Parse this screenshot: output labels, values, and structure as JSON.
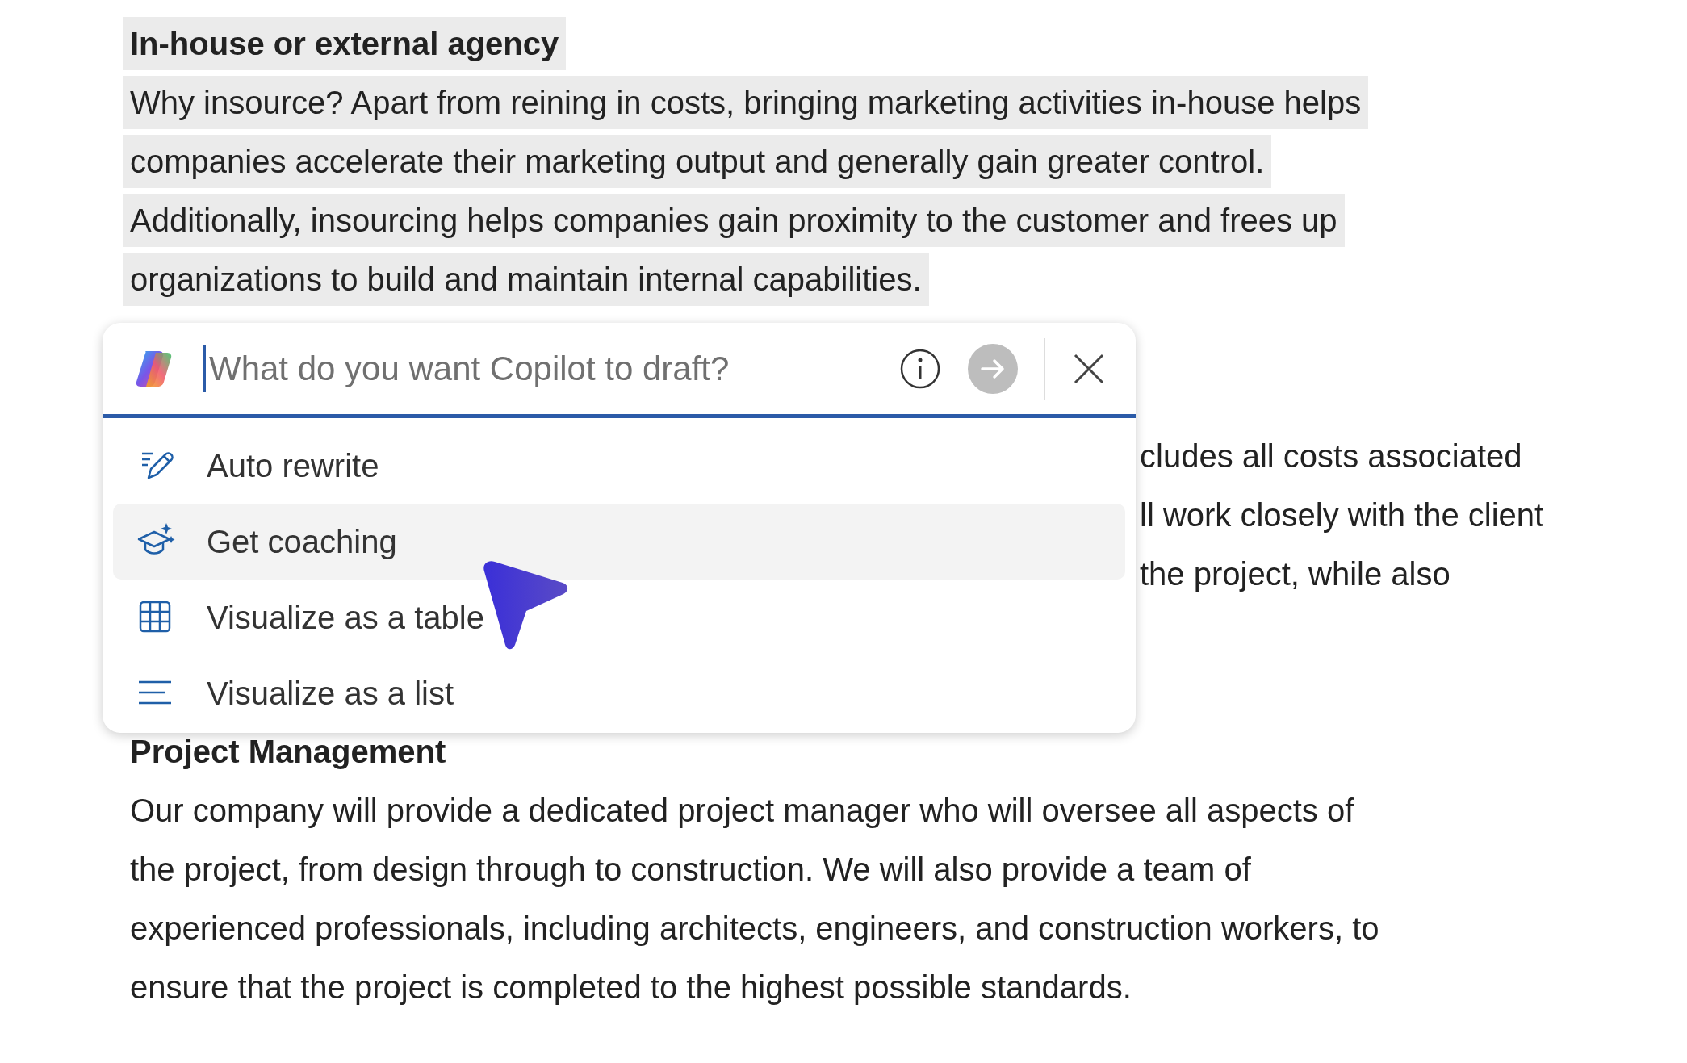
{
  "document": {
    "heading": "In-house or external agency",
    "highlighted_lines": [
      "Why insource? Apart from reining in costs, bringing marketing activities in-house helps",
      "companies accelerate their marketing output and generally gain greater control.",
      "Additionally, insourcing helps companies gain proximity to the customer and frees up",
      "organizations to build and maintain internal capabilities."
    ],
    "partly_hidden_lines": [
      "cludes all costs associated",
      "ll work closely with the client",
      "the project, while also"
    ],
    "section_heading": "Project Management",
    "paragraph_lines": [
      "Our company will provide a dedicated project manager who will oversee all aspects of",
      "the project, from design through to construction. We will also provide a team of",
      "experienced professionals, including architects, engineers, and construction workers, to",
      "ensure that the project is completed to the highest possible standards."
    ]
  },
  "copilot": {
    "prompt": {
      "placeholder": "What do you want Copilot to draft?"
    },
    "menu": [
      {
        "label": "Auto rewrite",
        "kind": "rewrite",
        "hovered": false
      },
      {
        "label": "Get coaching",
        "kind": "coaching",
        "hovered": true
      },
      {
        "label": "Visualize as a table",
        "kind": "table",
        "hovered": false
      },
      {
        "label": "Visualize as a list",
        "kind": "list",
        "hovered": false
      }
    ]
  }
}
